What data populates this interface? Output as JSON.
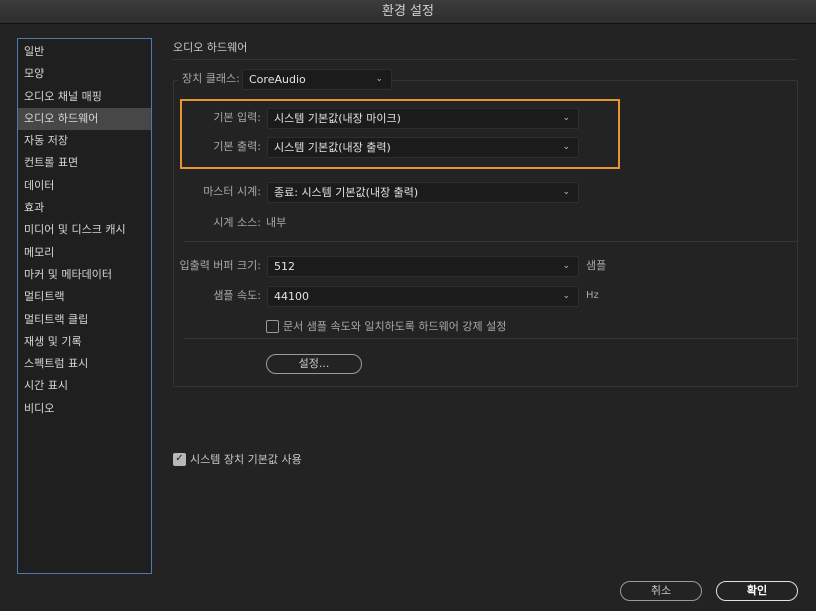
{
  "window": {
    "title": "환경 설정"
  },
  "sidebar": {
    "items": [
      {
        "label": "일반"
      },
      {
        "label": "모양"
      },
      {
        "label": "오디오 채널 매핑"
      },
      {
        "label": "오디오 하드웨어",
        "selected": true
      },
      {
        "label": "자동 저장"
      },
      {
        "label": "컨트롤 표면"
      },
      {
        "label": "데이터"
      },
      {
        "label": "효과"
      },
      {
        "label": "미디어 및 디스크 캐시"
      },
      {
        "label": "메모리"
      },
      {
        "label": "마커 및 메타데이터"
      },
      {
        "label": "멀티트랙"
      },
      {
        "label": "멀티트랙 클립"
      },
      {
        "label": "재생 및 기록"
      },
      {
        "label": "스펙트럼 표시"
      },
      {
        "label": "시간 표시"
      },
      {
        "label": "비디오"
      }
    ]
  },
  "main": {
    "section_title": "오디오 하드웨어",
    "device_class": {
      "label": "장치 클래스:",
      "value": "CoreAudio"
    },
    "default_input": {
      "label": "기본 입력:",
      "value": "시스템 기본값(내장 마이크)"
    },
    "default_output": {
      "label": "기본 출력:",
      "value": "시스템 기본값(내장 출력)"
    },
    "master_clock": {
      "label": "마스터 시계:",
      "value": "종료: 시스템 기본값(내장 출력)"
    },
    "clock_source": {
      "label": "시계 소스:",
      "value": "내부"
    },
    "buffer_size": {
      "label": "입출력 버퍼 크기:",
      "value": "512",
      "unit": "샘플"
    },
    "sample_rate": {
      "label": "샘플 속도:",
      "value": "44100",
      "unit": "Hz"
    },
    "force_rate": {
      "label": "문서 샘플 속도와 일치하도록 하드웨어 강제 설정",
      "checked": false
    },
    "settings_button": "설정...",
    "use_system_default": {
      "label": "시스템 장치 기본값 사용",
      "checked": true
    }
  },
  "footer": {
    "cancel": "취소",
    "ok": "확인"
  },
  "colors": {
    "highlight": "#e8952f",
    "sidebar_border": "#4d78b0"
  }
}
